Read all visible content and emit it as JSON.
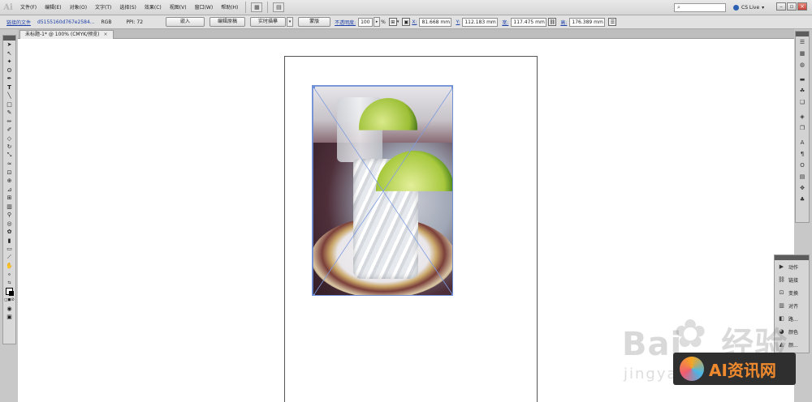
{
  "menubar": {
    "logo": "Ai",
    "items": [
      "文件(F)",
      "编辑(E)",
      "对象(O)",
      "文字(T)",
      "选择(S)",
      "效果(C)",
      "视图(V)",
      "窗口(W)",
      "帮助(H)"
    ],
    "cs_live": "CS Live"
  },
  "control": {
    "linked_file": "链接的文件",
    "file_name": "d5155160d767e2584...",
    "color_mode": "RGB",
    "ppi": "PPI: 72",
    "embed_btn": "嵌入",
    "edit_original_btn": "编辑原稿",
    "live_trace_btn": "实时描摹",
    "mask_btn": "蒙版",
    "opacity_label": "不透明度:",
    "opacity_value": "100",
    "opacity_unit": "%",
    "x_label": "X:",
    "x_value": "81.668 mm",
    "y_label": "Y:",
    "y_value": "112.183 mm",
    "w_label": "宽:",
    "w_value": "117.475 mm",
    "h_label": "高:",
    "h_value": "176.389 mm"
  },
  "document": {
    "tab_title": "未标题-1* @ 100% (CMYK/预览)",
    "tab_close": "×"
  },
  "panel": {
    "items": [
      {
        "label": "动作",
        "icon": "play-icon"
      },
      {
        "label": "链接",
        "icon": "link-icon"
      },
      {
        "label": "变换",
        "icon": "transform-icon"
      },
      {
        "label": "对齐",
        "icon": "align-icon"
      },
      {
        "label": "路...",
        "icon": "pathfinder-icon"
      },
      {
        "label": "颜色",
        "icon": "color-icon"
      },
      {
        "label": "颜...",
        "icon": "color-guide-icon"
      }
    ]
  },
  "watermark": {
    "text": "Bai",
    "text2": "经验",
    "sub": "jingya",
    "badge": "AI资讯网"
  }
}
